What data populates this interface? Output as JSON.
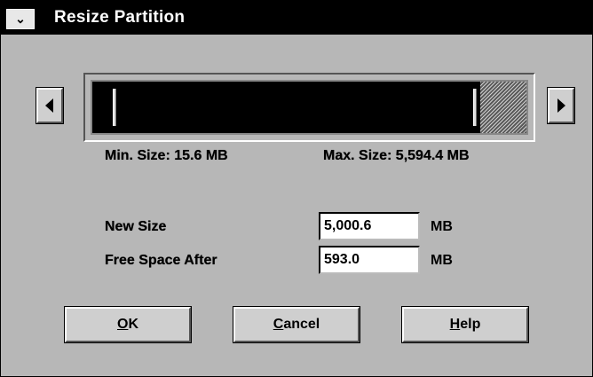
{
  "window": {
    "title": "Resize Partition",
    "sysmenu_glyph": "⌄"
  },
  "slider": {
    "left_arrow_icon": "triangle-left-icon",
    "right_arrow_icon": "triangle-right-icon",
    "used_fraction": 0.894,
    "min_handle_fraction": 0.003
  },
  "limits": {
    "min_label": "Min. Size: 15.6 MB",
    "max_label": "Max. Size: 5,594.4 MB"
  },
  "fields": {
    "new_size": {
      "label": "New Size",
      "value": "5,000.6",
      "unit": "MB"
    },
    "free_space": {
      "label": "Free Space After",
      "value": "593.0",
      "unit": "MB"
    }
  },
  "buttons": {
    "ok": {
      "mnemonic": "O",
      "rest": "K"
    },
    "cancel": {
      "mnemonic": "C",
      "rest": "ancel"
    },
    "help": {
      "mnemonic": "H",
      "rest": "elp"
    }
  }
}
